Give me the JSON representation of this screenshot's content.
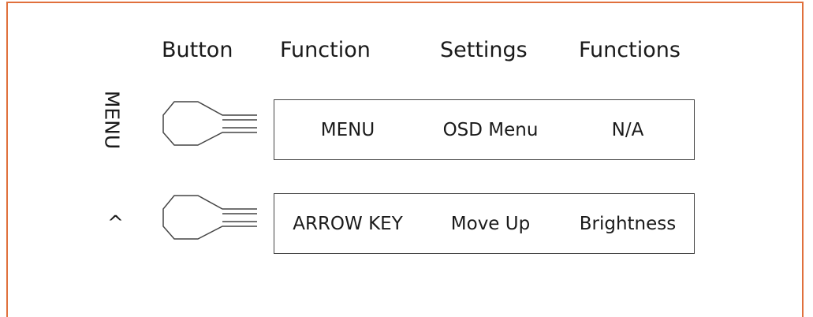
{
  "headers": {
    "button": "Button",
    "function": "Function",
    "settings": "Settings",
    "functions": "Functions"
  },
  "rows": [
    {
      "side_label": "MENU",
      "function": "MENU",
      "setting": "OSD Menu",
      "functions": "N/A"
    },
    {
      "side_label": "^",
      "function": "ARROW KEY",
      "setting": "Move Up",
      "functions": "Brightness"
    }
  ],
  "colors": {
    "frame_border": "#e0703c",
    "line": "#444444",
    "text": "#1a1a1a"
  },
  "icons": [
    "menu-button-key-icon",
    "up-button-key-icon"
  ]
}
